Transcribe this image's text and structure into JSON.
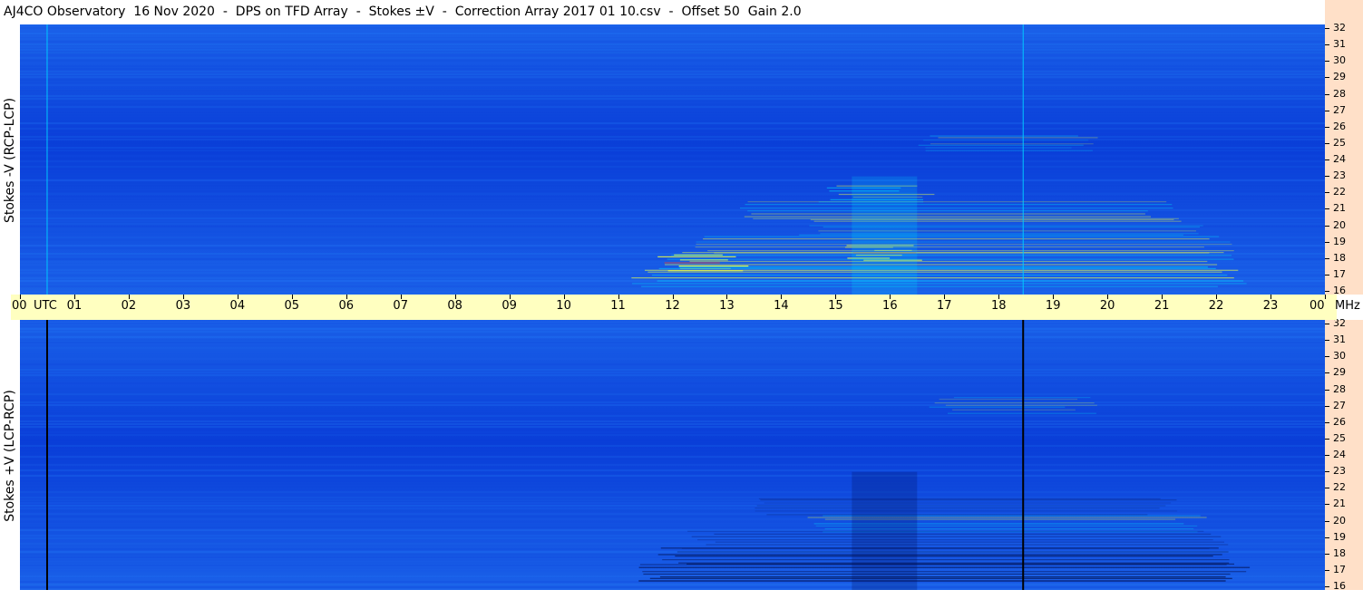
{
  "title": "AJ4CO Observatory  16 Nov 2020  -  DPS on TFD Array  -  Stokes ±V  -  Correction Array 2017 01 10.csv  -  Offset 50  Gain 2.0",
  "colors": {
    "background_low": "#0a3ed8",
    "background_mid": "#1a60e8",
    "background_high": "#2a8cff",
    "emission_cyan": "#00e6ff",
    "emission_yellow": "#f0ff40",
    "emission_red": "#ff4020",
    "time_axis_bg": "#ffffc0",
    "freq_axis_bg": "#ffe0c8"
  },
  "chart_data": [
    {
      "type": "heatmap",
      "name": "Stokes -V (RCP-LCP)",
      "ylabel": "Stokes -V (RCP-LCP)",
      "x_range": [
        0,
        24
      ],
      "y_range": [
        16,
        32
      ],
      "y_ticks": [
        "32",
        "31",
        "30",
        "29",
        "28",
        "27",
        "26",
        "25",
        "24",
        "23",
        "22",
        "21",
        "20",
        "19",
        "18",
        "17",
        "16"
      ],
      "markers": [
        {
          "x": 0.5,
          "color": "#00c8ff"
        },
        {
          "x": 18.45,
          "color": "#00c8ff"
        }
      ],
      "emission": [
        {
          "t_start": 11.9,
          "t_end": 13.2,
          "f": 17.9,
          "level": 1.0
        },
        {
          "t_start": 11.5,
          "t_end": 22.3,
          "f": 17.0,
          "level": 0.75
        },
        {
          "t_start": 12.0,
          "t_end": 22.0,
          "f": 18.0,
          "level": 0.7
        },
        {
          "t_start": 12.5,
          "t_end": 22.0,
          "f": 19.0,
          "level": 0.5
        },
        {
          "t_start": 14.5,
          "t_end": 21.5,
          "f": 20.0,
          "level": 0.45
        },
        {
          "t_start": 13.5,
          "t_end": 21.0,
          "f": 21.0,
          "level": 0.45
        },
        {
          "t_start": 15.0,
          "t_end": 16.5,
          "f": 22.0,
          "level": 0.55
        },
        {
          "t_start": 16.8,
          "t_end": 19.5,
          "f": 25.0,
          "level": 0.35
        },
        {
          "t_start": 15.5,
          "t_end": 16.3,
          "f": 18.5,
          "level": 0.9
        }
      ]
    },
    {
      "type": "heatmap",
      "name": "Stokes +V (LCP-RCP)",
      "ylabel": "Stokes +V (LCP-RCP)",
      "x_range": [
        0,
        24
      ],
      "y_range": [
        16,
        32
      ],
      "y_ticks": [
        "32",
        "31",
        "30",
        "29",
        "28",
        "27",
        "26",
        "25",
        "24",
        "23",
        "22",
        "21",
        "20",
        "19",
        "18",
        "17",
        "16"
      ],
      "markers": [
        {
          "x": 0.5,
          "color": "#000000"
        },
        {
          "x": 18.45,
          "color": "#000000"
        }
      ],
      "emission": [
        {
          "t_start": 11.5,
          "t_end": 22.3,
          "f": 17.0,
          "level": -0.9
        },
        {
          "t_start": 12.0,
          "t_end": 22.0,
          "f": 18.0,
          "level": -0.7
        },
        {
          "t_start": 12.5,
          "t_end": 22.0,
          "f": 19.0,
          "level": -0.5
        },
        {
          "t_start": 14.5,
          "t_end": 21.5,
          "f": 20.0,
          "level": 0.4
        },
        {
          "t_start": 13.5,
          "t_end": 21.0,
          "f": 21.0,
          "level": -0.4
        },
        {
          "t_start": 17.0,
          "t_end": 19.5,
          "f": 27.0,
          "level": 0.35
        }
      ]
    }
  ],
  "time_axis": {
    "ticks": [
      "00",
      "01",
      "02",
      "03",
      "04",
      "05",
      "06",
      "07",
      "08",
      "09",
      "10",
      "11",
      "12",
      "13",
      "14",
      "15",
      "16",
      "17",
      "18",
      "19",
      "20",
      "21",
      "22",
      "23",
      "00"
    ],
    "utc_label": "UTC",
    "unit_label": "MHz"
  }
}
